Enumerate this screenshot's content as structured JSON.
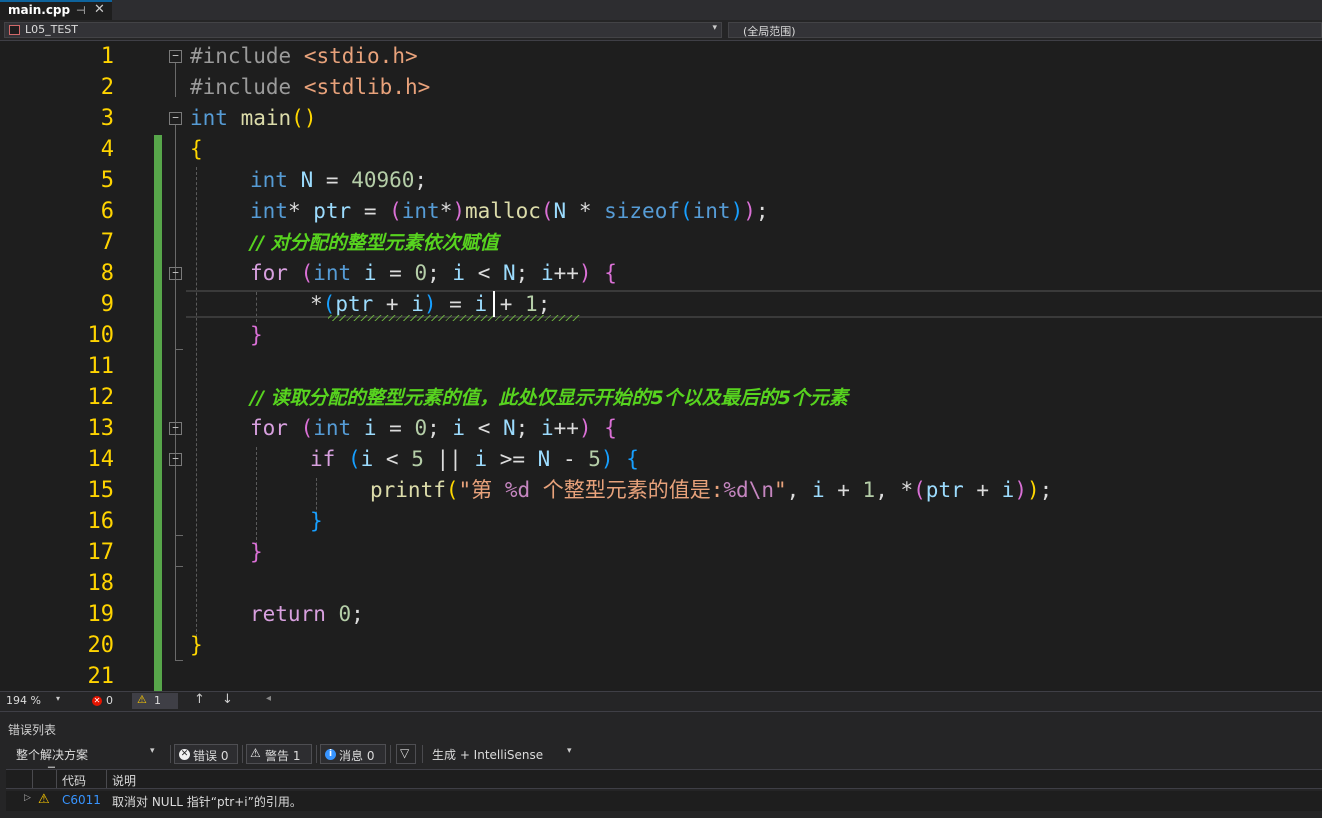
{
  "tab": {
    "filename": "main.cpp",
    "pin_glyph": "⊣",
    "close_glyph": "✕"
  },
  "navbar": {
    "project": "L05_TEST",
    "scope": "(全局范围)"
  },
  "editor": {
    "line_numbers": [
      "1",
      "2",
      "3",
      "4",
      "5",
      "6",
      "7",
      "8",
      "9",
      "10",
      "11",
      "12",
      "13",
      "14",
      "15",
      "16",
      "17",
      "18",
      "19",
      "20",
      "21"
    ],
    "include1_kw": "#include",
    "include1_hdr": "<stdio.h>",
    "include2_kw": "#include",
    "include2_hdr": "<stdlib.h>",
    "main_type": "int",
    "main_name": "main",
    "main_parens": "()",
    "brace_open": "{",
    "brace_close": "}",
    "l5_type": "int",
    "l5_var": "N",
    "l5_op": " = ",
    "l5_val": "40960",
    "l5_end": ";",
    "l6_type": "int",
    "l6_star": "*",
    "l6_var": " ptr",
    "l6_op": " = ",
    "l6_po": "(",
    "l6_ctype": "int",
    "l6_cstar": "*",
    "l6_pc": ")",
    "l6_fn": "malloc",
    "l6_fo": "(",
    "l6_n": "N",
    "l6_mul": " * ",
    "l6_sizeof": "sizeof",
    "l6_so": "(",
    "l6_sint": "int",
    "l6_sc": ")",
    "l6_fc": ")",
    "l6_end": ";",
    "comment1": "// 对分配的整型元素依次赋值",
    "for_kw": "for",
    "for_open": "(",
    "for_int": "int",
    "for_i": "i",
    "for_eq0": " = ",
    "for_zero": "0",
    "for_semi1": "; ",
    "for_i2": "i",
    "for_lt": " < ",
    "for_n": "N",
    "for_semi2": "; ",
    "for_i3": "i",
    "for_inc": "++",
    "for_close": ")",
    "for_brace": "{",
    "l9_star": "*",
    "l9_po": "(",
    "l9_ptr": "ptr",
    "l9_plus": " + ",
    "l9_i": "i",
    "l9_pc": ")",
    "l9_eq": " = ",
    "l9_i2": "i",
    "l9_plus2": " + ",
    "l9_one": "1",
    "l9_end": ";",
    "inner_close": "}",
    "comment2": "// 读取分配的整型元素的值，此处仅显示开始的5个以及最后的5个元素",
    "if_kw": "if",
    "if_open": "(",
    "if_i": "i",
    "if_lt": " < ",
    "if_5": "5",
    "if_or": " || ",
    "if_i2": "i",
    "if_ge": " >= ",
    "if_n": "N",
    "if_minus": " - ",
    "if_5b": "5",
    "if_close": ")",
    "if_brace": "{",
    "pf_fn": "printf",
    "pf_open": "(",
    "pf_str1": "\"第 ",
    "pf_fmt1": "%d",
    "pf_str2": " 个整型元素的值是:",
    "pf_fmt2": "%d\\n",
    "pf_str3": "\"",
    "pf_comma": ", ",
    "pf_i": "i",
    "pf_plus": " + ",
    "pf_one": "1",
    "pf_comma2": ", ",
    "pf_star": "*",
    "pf_po": "(",
    "pf_ptr": "ptr",
    "pf_plus2": " + ",
    "pf_i2": "i",
    "pf_pc": ")",
    "pf_close": ")",
    "pf_end": ";",
    "ret_kw": "return",
    "ret_val": "0",
    "ret_end": ";",
    "fold_glyph": "−"
  },
  "status": {
    "zoom": "194 %",
    "errors": "0",
    "warnings": "1",
    "err_glyph": "✕",
    "warn_glyph": "⚠",
    "up": "↑",
    "down": "↓",
    "left": "◂"
  },
  "error_list": {
    "title": "错误列表",
    "scope": "整个解决方案",
    "errors_btn": "错误 0",
    "warnings_btn": "警告 1",
    "messages_btn": "消息 0",
    "build_filter": "生成 + IntelliSense",
    "col_code": "代码",
    "col_desc": "说明",
    "rows": [
      {
        "code": "C6011",
        "description": "取消对 NULL 指针“ptr+i”的引用。"
      }
    ]
  },
  "colors": {
    "accent": "#0e639c",
    "line_numbers": "#ffd400",
    "keyword": "#569cd6",
    "comment": "#57d31f",
    "change_bar": "#57a64a",
    "warning": "#ffcc00"
  }
}
